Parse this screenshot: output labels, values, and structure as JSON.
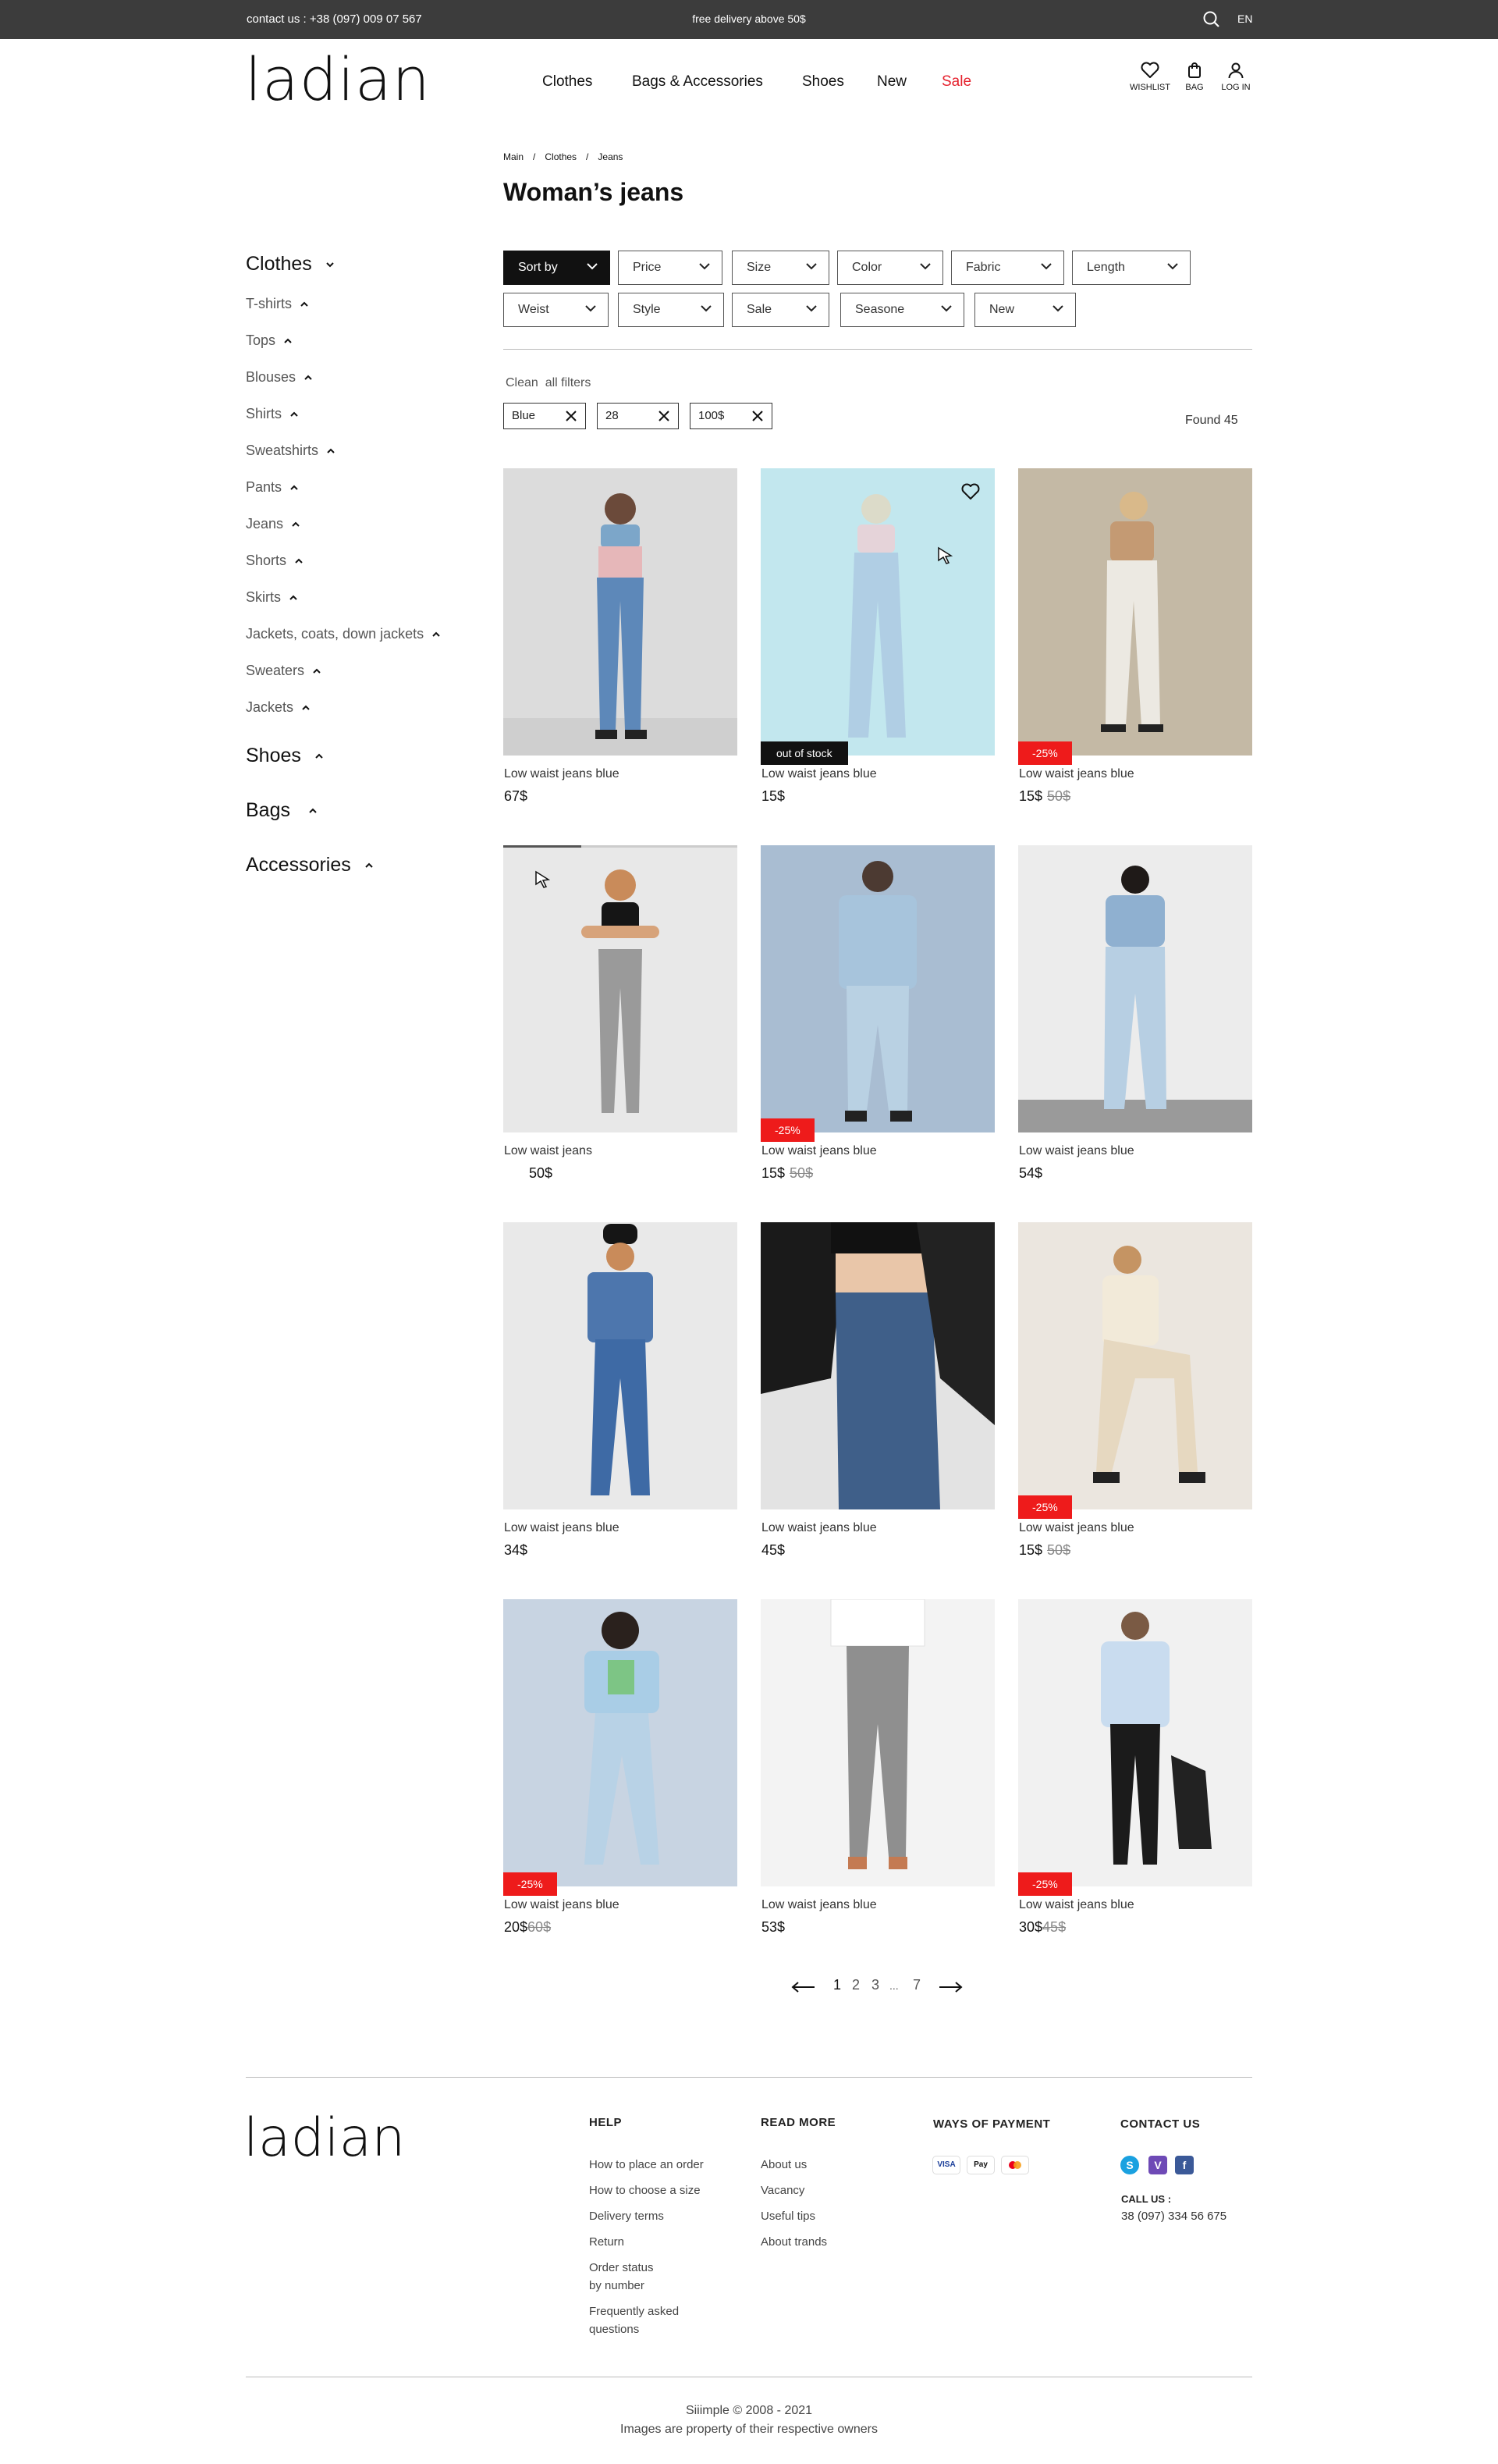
{
  "topbar": {
    "contact": "contact us : +38 (097) 009 07 567",
    "delivery": "free delivery above 50$",
    "lang": "EN"
  },
  "brand": {
    "logo": "ladian"
  },
  "nav": [
    "Clothes",
    "Bags & Accessories",
    "Shoes",
    "New",
    "Sale"
  ],
  "header_icons": {
    "wishlist": "WISHLIST",
    "bag": "BAG",
    "login": "LOG IN"
  },
  "breadcrumb": [
    "Main",
    "Clothes",
    "Jeans"
  ],
  "page_title": "Woman’s jeans",
  "sidebar": {
    "cat_clothes": "Clothes",
    "clothes_items": [
      "T-shirts",
      "Tops",
      "Blouses",
      "Shirts",
      "Sweatshirts",
      "Pants",
      "Jeans",
      "Shorts",
      "Skirts",
      "Jackets, coats, down jackets",
      "Sweaters",
      "Jackets"
    ],
    "cat_shoes": "Shoes",
    "cat_bags": "Bags",
    "cat_accessories": "Accessories"
  },
  "filters": [
    "Sort by",
    "Price",
    "Size",
    "Color",
    "Fabric",
    "Length",
    "Weist",
    "Style",
    "Sale",
    "Seasone",
    "New"
  ],
  "clean_filters": "Clean  all filters",
  "chips": [
    "Blue",
    "28",
    "100$"
  ],
  "found": "Found 45",
  "products": [
    {
      "name": "Low waist jeans blue",
      "price": "67$",
      "old": "",
      "badge": ""
    },
    {
      "name": "Low waist jeans blue",
      "price": "15$",
      "old": "",
      "badge": "out of stock"
    },
    {
      "name": "Low waist jeans blue",
      "price": "15$",
      "old": "50$",
      "badge": "-25%"
    },
    {
      "name": "Low waist jeans",
      "price": "50$",
      "old": "",
      "badge": ""
    },
    {
      "name": "Low waist jeans blue",
      "price": "15$",
      "old": "50$",
      "badge": "-25%"
    },
    {
      "name": "Low waist jeans blue",
      "price": "54$",
      "old": "",
      "badge": ""
    },
    {
      "name": "Low waist jeans blue",
      "price": "34$",
      "old": "",
      "badge": ""
    },
    {
      "name": "Low waist jeans blue",
      "price": "45$",
      "old": "",
      "badge": ""
    },
    {
      "name": "Low waist jeans blue",
      "price": "15$",
      "old": "50$",
      "badge": "-25%"
    },
    {
      "name": "Low waist jeans blue",
      "price": "20$",
      "old": "60$",
      "badge": "-25%"
    },
    {
      "name": "Low waist jeans blue",
      "price": "53$",
      "old": "",
      "badge": ""
    },
    {
      "name": "Low waist jeans blue",
      "price": "30$",
      "old": "45$",
      "badge": "-25%"
    }
  ],
  "pagination": {
    "pages": [
      "1",
      "2",
      "3",
      "...",
      "7"
    ]
  },
  "footer": {
    "logo": "ladian",
    "help_title": "HELP",
    "help_links": [
      "How to place an order",
      "How to choose a size",
      "Delivery terms",
      "Return",
      "Order status\nby number",
      "Frequently asked\nquestions"
    ],
    "read_title": "READ MORE",
    "read_links": [
      "About us",
      "Vacancy",
      "Useful tips",
      "About trands"
    ],
    "payment_title": "WAYS OF PAYMENT",
    "payment_methods": [
      "VISA",
      "Pay"
    ],
    "contact_title": "CONTACT US",
    "call_us": "CALL US :",
    "phone": "38 (097) 334 56 675",
    "copyright_1": "Siiimple © 2008 - 2021",
    "copyright_2": "Images are property of their respective owners"
  },
  "colors": {
    "accent_sale": "#e5212d",
    "badge_sale": "#ee1b1b",
    "topbar": "#3c3c3c"
  }
}
